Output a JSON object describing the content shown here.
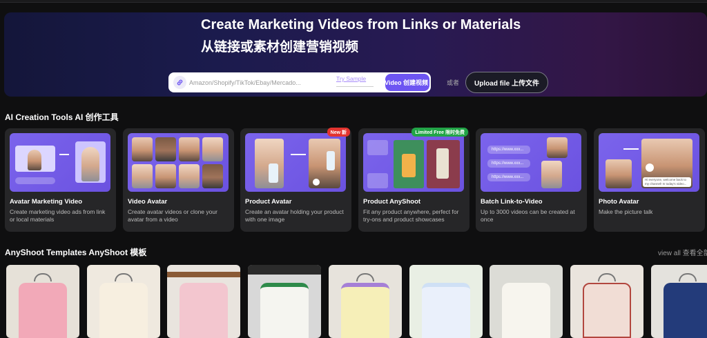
{
  "hero": {
    "title_en": "Create Marketing Videos from Links or Materials",
    "title_zh": "从链接或素材创建营销视频",
    "url_placeholder": "Amazon/Shopify/TikTok/Ebay/Mercado...",
    "try_sample": "Try Sample",
    "create_button": "ate Video  创建视频",
    "or_text": "或者",
    "upload_button": "Upload file  上传文件"
  },
  "tools_section": {
    "title": "AI Creation Tools  AI 创作工具",
    "cards": [
      {
        "title": "Avatar Marketing Video",
        "desc": "Create marketing video ads from link or local materials",
        "badge": ""
      },
      {
        "title": "Video Avatar",
        "desc": "Create avatar videos or clone your avatar from a video",
        "badge": ""
      },
      {
        "title": "Product Avatar",
        "desc": "Create an avatar holding your product with one image",
        "badge": "New  新"
      },
      {
        "title": "Product AnyShoot",
        "desc": "Fit any product anywhere, perfect for try-ons and product showcases",
        "badge": "Limited Free  限时免费"
      },
      {
        "title": "Batch Link-to-Video",
        "desc": "Up to 3000 videos can be created at once",
        "badge": ""
      },
      {
        "title": "Photo Avatar",
        "desc": "Make the picture talk",
        "badge": ""
      }
    ],
    "preview_texts": {
      "url_row": "https://www.xxx...",
      "speech": "Hi everyone, welcome back to my channel! In today's video..."
    }
  },
  "templates_section": {
    "title": "AnyShoot Templates  AnyShoot 模板",
    "view_all": "view all  查看全部"
  },
  "colors": {
    "accent": "#6d55f2",
    "card_preview": "#7b64ec",
    "badge_new": "#e3342f",
    "badge_free": "#22a447"
  }
}
